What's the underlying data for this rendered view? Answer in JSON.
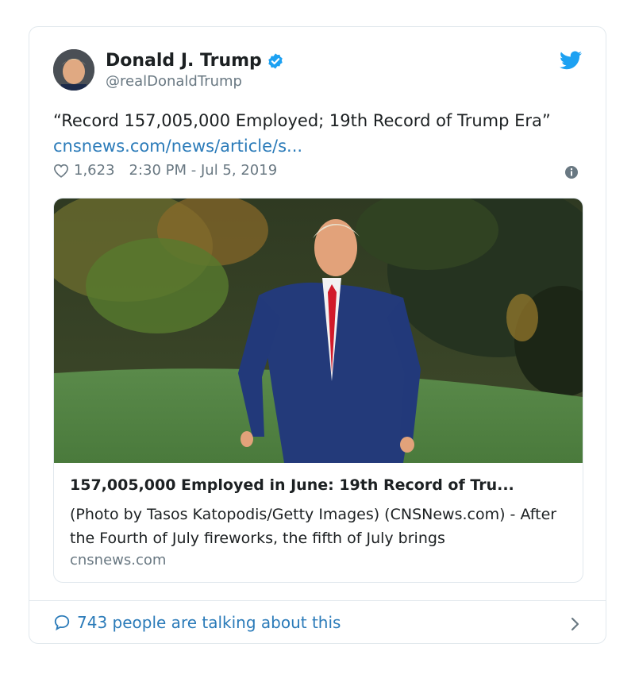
{
  "tweet": {
    "author": {
      "name": "Donald J. Trump",
      "handle": "@realDonaldTrump",
      "verified": true,
      "avatar_icon": "avatar-photo"
    },
    "text_main": "“Record 157,005,000 Employed; 19th Record of Trump Era” ",
    "link_text": "cnsnews.com/news/article/s...",
    "likes": "1,623",
    "timestamp": "2:30 PM - Jul 5, 2019",
    "icons": {
      "brand": "twitter-bird-icon",
      "like": "heart-icon",
      "info": "info-icon",
      "reply": "speech-bubble-icon",
      "more": "chevron-right-icon"
    }
  },
  "card": {
    "image_icon": "article-photo",
    "title": "157,005,000 Employed in June: 19th Record of Tru...",
    "description": "(Photo by Tasos Katopodis/Getty Images) (CNSNews.com) - After the Fourth of July fireworks, the fifth of July brings",
    "domain": "cnsnews.com"
  },
  "footer": {
    "label": "743 people are talking about this"
  },
  "colors": {
    "link": "#2b7bb9",
    "twitter_blue": "#1da1f2",
    "muted": "#697882",
    "border": "#e1e8ed",
    "text": "#1c2022"
  }
}
